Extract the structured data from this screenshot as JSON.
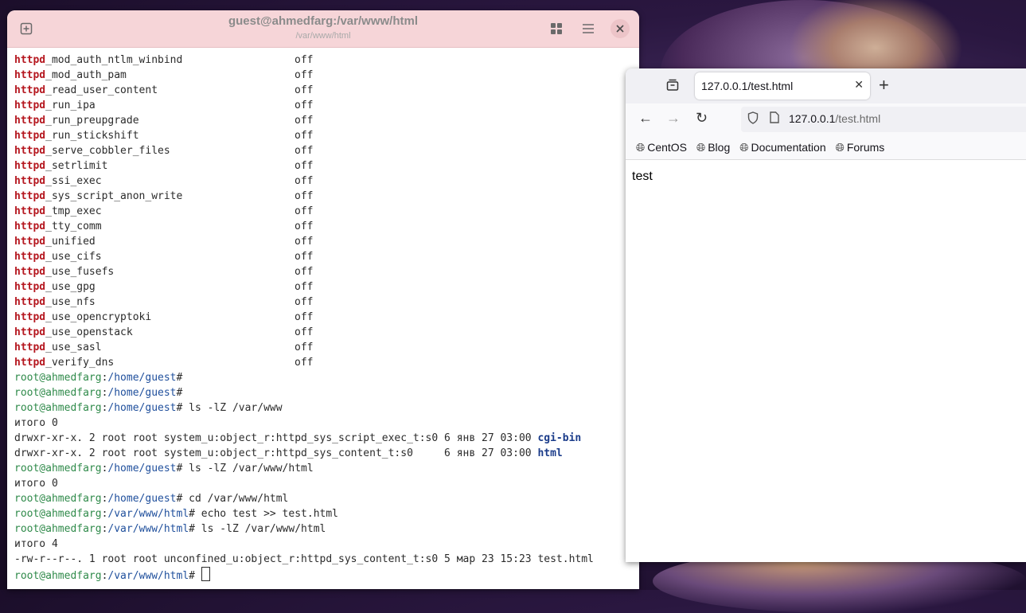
{
  "terminal": {
    "title": "guest@ahmedfarg:/var/www/html",
    "subtitle": "/var/www/html",
    "booleans": [
      {
        "prefix": "httpd",
        "rest": "_mod_auth_ntlm_winbind",
        "state": "off"
      },
      {
        "prefix": "httpd",
        "rest": "_mod_auth_pam",
        "state": "off"
      },
      {
        "prefix": "httpd",
        "rest": "_read_user_content",
        "state": "off"
      },
      {
        "prefix": "httpd",
        "rest": "_run_ipa",
        "state": "off"
      },
      {
        "prefix": "httpd",
        "rest": "_run_preupgrade",
        "state": "off"
      },
      {
        "prefix": "httpd",
        "rest": "_run_stickshift",
        "state": "off"
      },
      {
        "prefix": "httpd",
        "rest": "_serve_cobbler_files",
        "state": "off"
      },
      {
        "prefix": "httpd",
        "rest": "_setrlimit",
        "state": "off"
      },
      {
        "prefix": "httpd",
        "rest": "_ssi_exec",
        "state": "off"
      },
      {
        "prefix": "httpd",
        "rest": "_sys_script_anon_write",
        "state": "off"
      },
      {
        "prefix": "httpd",
        "rest": "_tmp_exec",
        "state": "off"
      },
      {
        "prefix": "httpd",
        "rest": "_tty_comm",
        "state": "off"
      },
      {
        "prefix": "httpd",
        "rest": "_unified",
        "state": "off"
      },
      {
        "prefix": "httpd",
        "rest": "_use_cifs",
        "state": "off"
      },
      {
        "prefix": "httpd",
        "rest": "_use_fusefs",
        "state": "off"
      },
      {
        "prefix": "httpd",
        "rest": "_use_gpg",
        "state": "off"
      },
      {
        "prefix": "httpd",
        "rest": "_use_nfs",
        "state": "off"
      },
      {
        "prefix": "httpd",
        "rest": "_use_opencryptoki",
        "state": "off"
      },
      {
        "prefix": "httpd",
        "rest": "_use_openstack",
        "state": "off"
      },
      {
        "prefix": "httpd",
        "rest": "_use_sasl",
        "state": "off"
      },
      {
        "prefix": "httpd",
        "rest": "_verify_dns",
        "state": "off"
      }
    ],
    "session": [
      {
        "prompt_user": "root@ahmedfarg",
        "prompt_path": "/home/guest",
        "cmd": ""
      },
      {
        "prompt_user": "root@ahmedfarg",
        "prompt_path": "/home/guest",
        "cmd": ""
      },
      {
        "prompt_user": "root@ahmedfarg",
        "prompt_path": "/home/guest",
        "cmd": " ls -lZ /var/www"
      },
      {
        "output": "итого 0"
      },
      {
        "output": "drwxr-xr-x. 2 root root system_u:object_r:httpd_sys_script_exec_t:s0 6 янв 27 03:00 ",
        "highlight": "cgi-bin"
      },
      {
        "output": "drwxr-xr-x. 2 root root system_u:object_r:httpd_sys_content_t:s0     6 янв 27 03:00 ",
        "highlight": "html"
      },
      {
        "prompt_user": "root@ahmedfarg",
        "prompt_path": "/home/guest",
        "cmd": " ls -lZ /var/www/html"
      },
      {
        "output": "итого 0"
      },
      {
        "prompt_user": "root@ahmedfarg",
        "prompt_path": "/home/guest",
        "cmd": " cd /var/www/html"
      },
      {
        "prompt_user": "root@ahmedfarg",
        "prompt_path": "/var/www/html",
        "cmd": " echo test >> test.html"
      },
      {
        "prompt_user": "root@ahmedfarg",
        "prompt_path": "/var/www/html",
        "cmd": " ls -lZ /var/www/html"
      },
      {
        "output": "итого 4"
      },
      {
        "output": "-rw-r--r--. 1 root root unconfined_u:object_r:httpd_sys_content_t:s0 5 мар 23 15:23 test.html"
      },
      {
        "prompt_user": "root@ahmedfarg",
        "prompt_path": "/var/www/html",
        "cmd": " ",
        "cursor": true
      }
    ]
  },
  "browser": {
    "tab_title": "127.0.0.1/test.html",
    "url_host": "127.0.0.1",
    "url_path": "/test.html",
    "bookmarks": [
      "CentOS",
      "Blog",
      "Documentation",
      "Forums"
    ],
    "page_text": "test"
  },
  "colors": {
    "terminal_header": "#f6d5d8",
    "httpd_red": "#b5171f",
    "prompt_green": "#2f8a4a",
    "path_blue": "#1f4f9c"
  }
}
